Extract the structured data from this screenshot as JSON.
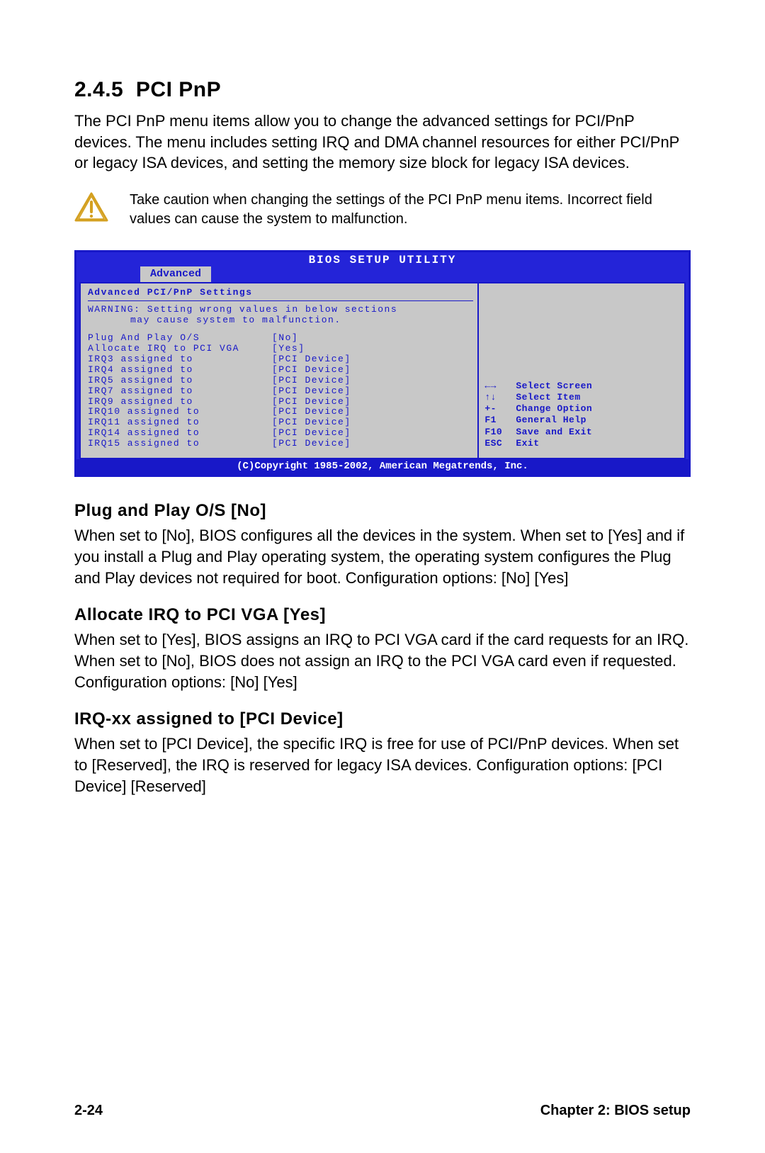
{
  "section": {
    "number": "2.4.5",
    "title": "PCI PnP",
    "intro": "The PCI PnP menu items allow you to change the advanced settings for PCI/PnP devices. The menu includes setting IRQ and DMA channel resources for either PCI/PnP or legacy ISA devices, and setting the memory size block for legacy ISA devices."
  },
  "caution": {
    "text": "Take caution when changing the settings of the PCI PnP menu items. Incorrect field values can cause the system to malfunction."
  },
  "bios": {
    "title": "BIOS SETUP UTILITY",
    "tab": "Advanced",
    "header": "Advanced PCI/PnP Settings",
    "warning_l1": "WARNING: Setting wrong values in below sections",
    "warning_l2": "may cause system to malfunction.",
    "rows": [
      {
        "label": "Plug And Play O/S",
        "value": "[No]"
      },
      {
        "label": "Allocate IRQ to PCI VGA",
        "value": "[Yes]"
      },
      {
        "label": "IRQ3 assigned to",
        "value": "[PCI Device]"
      },
      {
        "label": "IRQ4 assigned to",
        "value": "[PCI Device]"
      },
      {
        "label": "IRQ5 assigned to",
        "value": "[PCI Device]"
      },
      {
        "label": "IRQ7 assigned to",
        "value": "[PCI Device]"
      },
      {
        "label": "IRQ9 assigned to",
        "value": "[PCI Device]"
      },
      {
        "label": "IRQ10 assigned to",
        "value": "[PCI Device]"
      },
      {
        "label": "IRQ11 assigned to",
        "value": "[PCI Device]"
      },
      {
        "label": "IRQ14 assigned to",
        "value": "[PCI Device]"
      },
      {
        "label": "IRQ15 assigned to",
        "value": "[PCI Device]"
      }
    ],
    "nav": [
      {
        "key": "←→",
        "label": "Select Screen"
      },
      {
        "key": "↑↓",
        "label": "Select Item"
      },
      {
        "key": "+-",
        "label": "Change Option"
      },
      {
        "key": "F1",
        "label": "General Help"
      },
      {
        "key": "F10",
        "label": "Save and Exit"
      },
      {
        "key": "ESC",
        "label": "Exit"
      }
    ],
    "footer": "(C)Copyright 1985-2002, American Megatrends, Inc."
  },
  "subsections": [
    {
      "heading": "Plug and Play O/S [No]",
      "body": "When set to [No], BIOS configures all the devices in the system. When set to [Yes] and if you install a Plug and Play operating system, the operating system configures the Plug and Play devices not required for boot. Configuration options: [No] [Yes]"
    },
    {
      "heading": "Allocate IRQ to PCI VGA [Yes]",
      "body": "When set to [Yes], BIOS assigns an IRQ to PCI VGA card if the card requests for an IRQ. When set to [No], BIOS does not assign an IRQ to the PCI VGA card even if requested. Configuration options: [No] [Yes]"
    },
    {
      "heading": "IRQ-xx assigned to [PCI Device]",
      "body": "When set to [PCI Device], the specific IRQ is free for use of PCI/PnP devices. When set to [Reserved], the IRQ is reserved for legacy ISA devices. Configuration options: [PCI Device] [Reserved]"
    }
  ],
  "footer": {
    "left": "2-24",
    "right": "Chapter 2: BIOS setup"
  }
}
